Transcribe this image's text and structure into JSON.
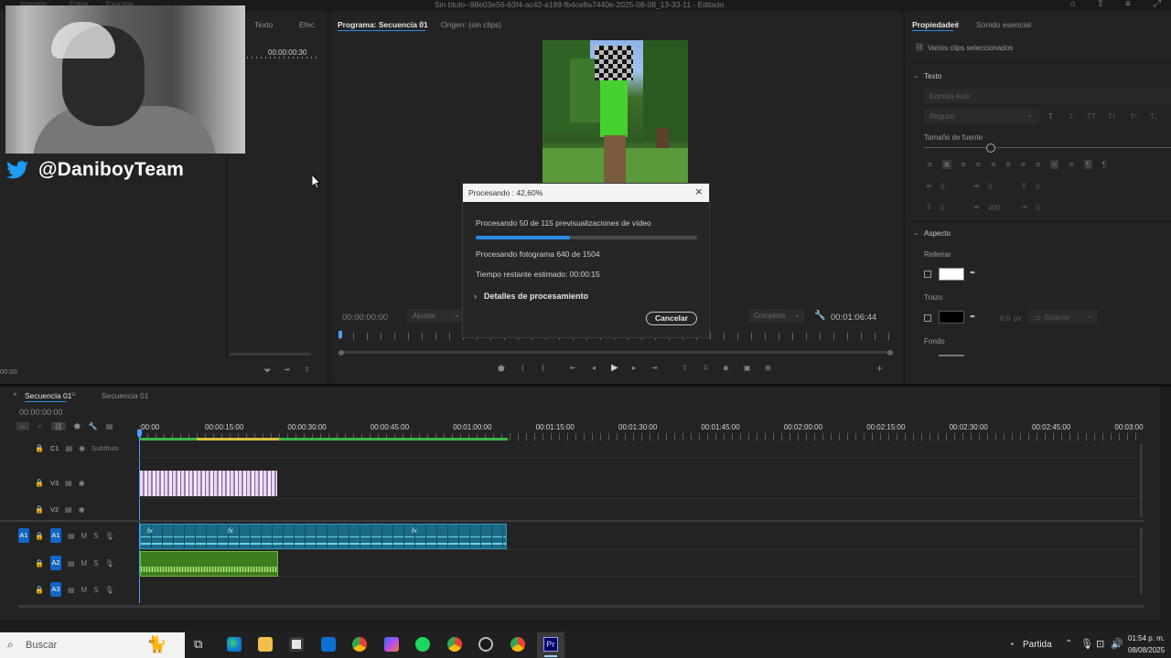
{
  "window": {
    "title": "Sin título--98e03e56-63f4-ac42-a189-fb4ce8a7440e-2025-08-08_13-33-11 - Editado",
    "menu": [
      "Importar",
      "Editar",
      "Exportar"
    ]
  },
  "overlay": {
    "handle": "@DaniboyTeam"
  },
  "left_panel": {
    "tabs": [
      "Texto",
      "Efec"
    ],
    "timecode": "00:00:00:30",
    "bottom_timecode": "00:00"
  },
  "program_monitor": {
    "tab_active": "Programa: Secuencia 01",
    "tab_source": "Origen: (sin clips)",
    "timecode_current": "00:00:00:00",
    "fit_label": "Ajustar",
    "quality_label": "Completa",
    "timecode_duration": "00:01:06:44"
  },
  "dialog": {
    "title": "Procesando : 42,60%",
    "line1": "Procesando 50 de 115 previsualizaciones de vídeo",
    "progress_fraction": 0.426,
    "line2": "Procesando fotograma 640 de 1504",
    "line3": "Tiempo restante estimado: 00:00:15",
    "details_label": "Detalles de procesamiento",
    "cancel_label": "Cancelar",
    "accent_color": "#2d8ceb"
  },
  "properties": {
    "tab_active": "Propiedades",
    "tab_other": "Sonido esencial",
    "selection": "Varios clips seleccionados",
    "section_text": "Texto",
    "font_name": "Komika Axis",
    "font_style": "Regular",
    "font_size_label": "Tamaño de fuente",
    "values": [
      "0",
      "0",
      "0",
      "0",
      "400",
      "0"
    ],
    "section_aspect": "Aspecto",
    "fill_label": "Rellenar",
    "fill_color": "#ffffff",
    "stroke_label": "Trazo",
    "stroke_color": "#000000",
    "stroke_value": "8.0",
    "stroke_unit": "px",
    "stroke_position": "Exterior",
    "background_label": "Fondo"
  },
  "timeline": {
    "tab_active": "Secuencia 01",
    "tab_other": "Secuencia 01",
    "timecode": "00:00:00:00",
    "ruler_labels": [
      "00:00:15:00",
      "00:00:30:00",
      "00:00:45:00",
      "00:01:00:00",
      "00:01:15:00",
      "00:01:30:00",
      "00:01:45:00",
      "00:02:00:00",
      "00:02:15:00",
      "00:02:30:00",
      "00:02:45:00",
      "00:03:00"
    ],
    "ruler_start": ":00:00",
    "tracks": {
      "c1": "C1",
      "subtitle": "Subtítulo",
      "v3": "V3",
      "v2": "V2",
      "a1_src": "A1",
      "a1": "A1",
      "a2": "A2",
      "a3": "A3",
      "m": "M",
      "s": "S"
    },
    "fx_label": "fx"
  },
  "taskbar": {
    "search_placeholder": "Buscar",
    "game_label": "Partida",
    "time": "01:54 p. m.",
    "date": "08/08/2025"
  }
}
